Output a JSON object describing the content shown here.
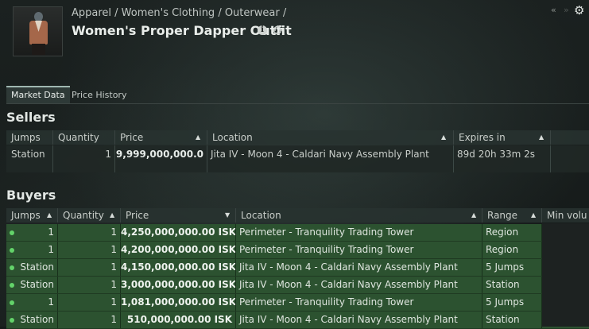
{
  "breadcrumb": "Apparel / Women's Clothing / Outerwear /",
  "item_title": "Women's Proper Dapper Outfit",
  "info_icon_glyph": "i",
  "tabs": [
    "Market Data",
    "Price History"
  ],
  "sellers": {
    "title": "Sellers",
    "columns": [
      "Jumps",
      "Quantity",
      "Price",
      "Location",
      "Expires in"
    ],
    "rows": [
      {
        "jumps": "Station",
        "quantity": "1",
        "price": "9,999,000,000.0",
        "location": "Jita IV - Moon 4 - Caldari Navy Assembly Plant",
        "expires": "89d 20h 33m 2s"
      }
    ]
  },
  "buyers": {
    "title": "Buyers",
    "columns": [
      "Jumps",
      "Quantity",
      "Price",
      "Location",
      "Range",
      "Min volu"
    ],
    "rows": [
      {
        "jumps": "1",
        "quantity": "1",
        "price": "4,250,000,000.00 ISK",
        "location": "Perimeter - Tranquility Trading Tower",
        "range": "Region"
      },
      {
        "jumps": "1",
        "quantity": "1",
        "price": "4,200,000,000.00 ISK",
        "location": "Perimeter - Tranquility Trading Tower",
        "range": "Region"
      },
      {
        "jumps": "Station",
        "quantity": "1",
        "price": "4,150,000,000.00 ISK",
        "location": "Jita IV - Moon 4 - Caldari Navy Assembly Plant",
        "range": "5 Jumps"
      },
      {
        "jumps": "Station",
        "quantity": "1",
        "price": "3,000,000,000.00 ISK",
        "location": "Jita IV - Moon 4 - Caldari Navy Assembly Plant",
        "range": "Station"
      },
      {
        "jumps": "1",
        "quantity": "1",
        "price": "1,081,000,000.00 ISK",
        "location": "Perimeter - Tranquility Trading Tower",
        "range": "5 Jumps"
      },
      {
        "jumps": "Station",
        "quantity": "1",
        "price": "510,000,000.00 ISK",
        "location": "Jita IV - Moon 4 - Caldari Navy Assembly Plant",
        "range": "Station"
      }
    ]
  },
  "icons": {
    "collapse": "«",
    "expand": "»",
    "gear": "⚙",
    "sort_up": "▲",
    "sort_down": "▼"
  },
  "colors": {
    "buy_row": "#2c5230",
    "status_dot": "#63d36a",
    "background": "#151a19"
  }
}
